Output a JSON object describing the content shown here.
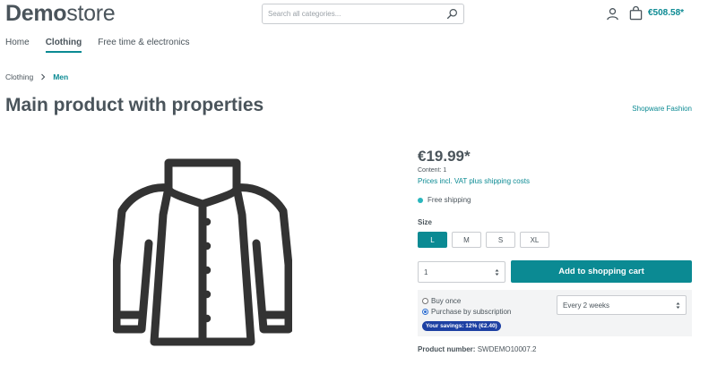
{
  "header": {
    "logo_bold": "Demo",
    "logo_light": "store",
    "search_placeholder": "Search all categories...",
    "cart_total": "€508.58*"
  },
  "nav": {
    "items": [
      {
        "label": "Home",
        "active": false
      },
      {
        "label": "Clothing",
        "active": true
      },
      {
        "label": "Free time & electronics",
        "active": false
      }
    ]
  },
  "breadcrumb": {
    "parent": "Clothing",
    "current": "Men"
  },
  "product": {
    "title": "Main product with properties",
    "manufacturer": "Shopware Fashion",
    "image_icon": "jacket-icon",
    "price": "€19.99*",
    "content": "Content: 1",
    "vat_note": "Prices incl. VAT plus shipping costs",
    "shipping": "Free shipping",
    "size_label": "Size",
    "sizes": [
      {
        "label": "L",
        "selected": true
      },
      {
        "label": "M",
        "selected": false
      },
      {
        "label": "S",
        "selected": false
      },
      {
        "label": "XL",
        "selected": false
      }
    ],
    "quantity": "1",
    "add_to_cart": "Add to shopping cart",
    "subscription": {
      "buy_once": "Buy once",
      "by_subscription": "Purchase by subscription",
      "savings": "Your savings: 12% (€2.40)",
      "interval": "Every 2 weeks"
    },
    "product_number_label": "Product number:",
    "product_number": "SWDEMO10007.2"
  },
  "colors": {
    "accent": "#0b8a93",
    "text": "#4a545b",
    "savings_badge": "#1d40a3"
  }
}
